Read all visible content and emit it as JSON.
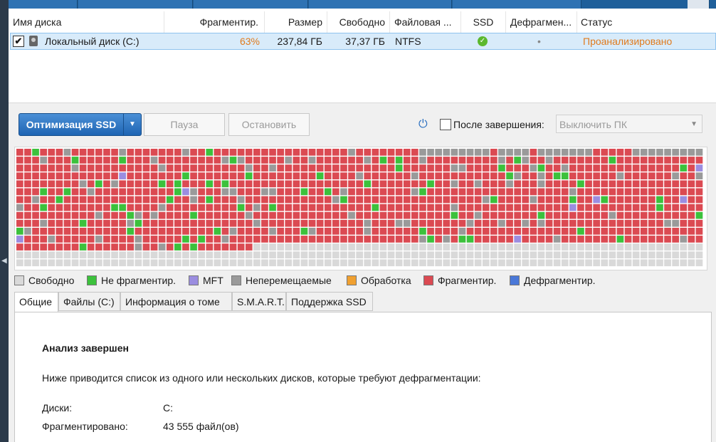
{
  "colors": {
    "free": "#d9d9d9",
    "not_fragmented": "#3cc13c",
    "mft": "#9b8de0",
    "unmovable": "#9a9a9a",
    "processing": "#f0a030",
    "fragmented": "#db4a52",
    "defragmented": "#4a78d8",
    "accent": "#e07b1e"
  },
  "columns": [
    "Имя диска",
    "Фрагментир.",
    "Размер",
    "Свободно",
    "Файловая ...",
    "SSD",
    "Дефрагмен...",
    "Статус"
  ],
  "disk": {
    "name": "Локальный диск (C:)",
    "frag": "63%",
    "size": "237,84 ГБ",
    "free": "37,37 ГБ",
    "fs": "NTFS",
    "ssd_icon": "check-circle-icon",
    "defrag": "•",
    "status": "Проанализировано",
    "checked": true
  },
  "toolbar": {
    "optimize": "Оптимизация SSD",
    "pause": "Пауза",
    "stop": "Остановить",
    "after_label": "После завершения:",
    "after_value": "Выключить ПК"
  },
  "legend": [
    "Свободно",
    "Не фрагментир.",
    "MFT",
    "Неперемещаемые",
    "Обработка",
    "Фрагментир.",
    "Дефрагментир."
  ],
  "tabs": [
    "Общие",
    "Файлы (C:)",
    "Информация о томе",
    "S.M.A.R.T.",
    "Поддержка SSD"
  ],
  "panel": {
    "title": "Анализ завершен",
    "description": "Ниже приводится список из одного или нескольких дисков, которые требуют дефрагментации:",
    "disks_label": "Диски:",
    "disks_value": "C:",
    "fragmented_label": "Фрагментировано:",
    "fragmented_value": "43 555 файл(ов)"
  }
}
